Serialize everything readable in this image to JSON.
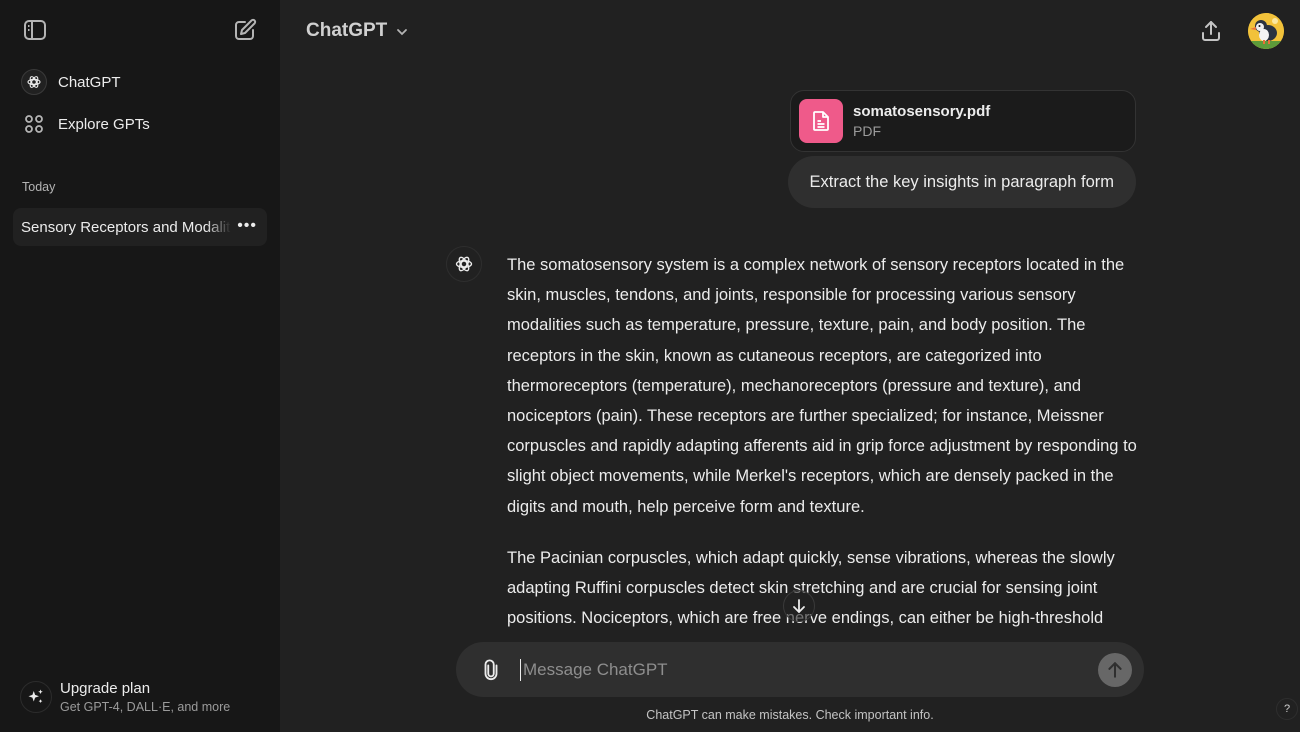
{
  "sidebar": {
    "toggle_icon": "sidebar-toggle-icon",
    "new_chat_icon": "new-chat-icon",
    "nav": [
      {
        "label": "ChatGPT",
        "icon": "openai-logo-icon"
      },
      {
        "label": "Explore GPTs",
        "icon": "grid-icon"
      }
    ],
    "section_label": "Today",
    "history": [
      {
        "title": "Sensory Receptors and Modalities",
        "menu": "•••"
      }
    ],
    "upgrade": {
      "title": "Upgrade plan",
      "subtitle": "Get GPT-4, DALL·E, and more",
      "icon": "sparkles-icon"
    }
  },
  "header": {
    "model_label": "ChatGPT",
    "share_icon": "share-icon",
    "avatar": "puffin-avatar"
  },
  "conversation": {
    "attachment": {
      "name": "somatosensory.pdf",
      "type": "PDF",
      "color": "#ef5a8a"
    },
    "user_message": "Extract the key insights in paragraph form",
    "assistant_paragraphs": [
      "The somatosensory system is a complex network of sensory receptors located in the skin, muscles, tendons, and joints, responsible for processing various sensory modalities such as temperature, pressure, texture, pain, and body position. The receptors in the skin, known as cutaneous receptors, are categorized into thermoreceptors (temperature), mechanoreceptors (pressure and texture), and nociceptors (pain). These receptors are further specialized; for instance, Meissner corpuscles and rapidly adapting afferents aid in grip force adjustment by responding to slight object movements, while Merkel's receptors, which are densely packed in the digits and mouth, help perceive form and texture.",
      "The Pacinian corpuscles, which adapt quickly, sense vibrations, whereas the slowly adapting Ruffini corpuscles detect skin stretching and are crucial for sensing joint positions. Nociceptors, which are free nerve endings, can either be high-threshold"
    ]
  },
  "composer": {
    "placeholder": "Message ChatGPT",
    "value": "",
    "attach_icon": "paperclip-icon",
    "send_icon": "arrow-up-icon"
  },
  "footer": {
    "disclaimer": "ChatGPT can make mistakes. Check important info.",
    "help": "?"
  }
}
